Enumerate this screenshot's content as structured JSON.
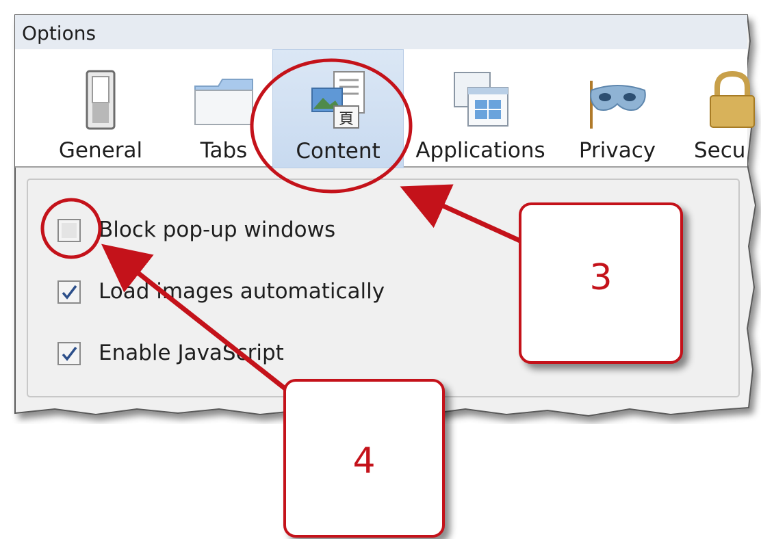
{
  "window": {
    "title": "Options"
  },
  "toolbar": {
    "selected": "Content",
    "items": [
      {
        "label": "General",
        "icon": "switch-icon"
      },
      {
        "label": "Tabs",
        "icon": "tabs-folder-icon"
      },
      {
        "label": "Content",
        "icon": "content-page-icon"
      },
      {
        "label": "Applications",
        "icon": "applications-window-icon"
      },
      {
        "label": "Privacy",
        "icon": "privacy-mask-icon"
      },
      {
        "label": "Secu",
        "icon": "security-lock-icon"
      }
    ]
  },
  "options": [
    {
      "label": "Block pop-up windows",
      "checked": false
    },
    {
      "label": "Load images automatically",
      "checked": true
    },
    {
      "label": "Enable JavaScript",
      "checked": true
    }
  ],
  "callouts": [
    {
      "number": "3"
    },
    {
      "number": "4"
    }
  ],
  "colors": {
    "annotation": "#c4121a",
    "selected_tab": "#c8daf0",
    "panel": "#f0f0f0"
  }
}
